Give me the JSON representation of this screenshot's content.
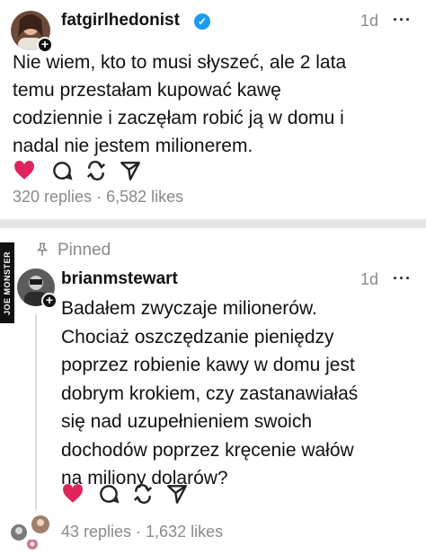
{
  "post_main": {
    "username": "fatgirlhedonist",
    "verified": true,
    "time": "1d",
    "more_label": "···",
    "text_lines": [
      "Nie wiem, kto to musi słyszeć, ale 2 lata",
      "temu przestałam kupować kawę",
      "codziennie i zaczęłam robić ją w domu i",
      "nadal nie jestem milionerem."
    ],
    "replies": "320 replies",
    "separator": " · ",
    "likes": "6,582 likes",
    "liked": true
  },
  "reply": {
    "pinned_label": "Pinned",
    "username": "brianmstewart",
    "time": "1d",
    "more_label": "···",
    "text_lines": [
      "Badałem zwyczaje milionerów.",
      "Chociaż oszczędzanie pieniędzy",
      "poprzez robienie kawy w domu jest",
      "dobrym krokiem, czy zastanawiałaś",
      "się nad uzupełnieniem swoich",
      "dochodów poprzez kręcenie wałów",
      "na miliony dolarów?"
    ],
    "replies": "43 replies",
    "separator": " · ",
    "likes": "1,632 likes",
    "liked": true
  },
  "watermark": "JOE MONSTER",
  "colors": {
    "like_red": "#e0245e",
    "verified_blue": "#1d9bf0",
    "muted_text": "#8a8a8a",
    "divider": "#e6e6e6"
  },
  "icons": [
    "heart-icon",
    "comment-icon",
    "repost-icon",
    "share-icon",
    "verified-icon",
    "more-icon",
    "pin-icon",
    "follow-plus-icon"
  ]
}
